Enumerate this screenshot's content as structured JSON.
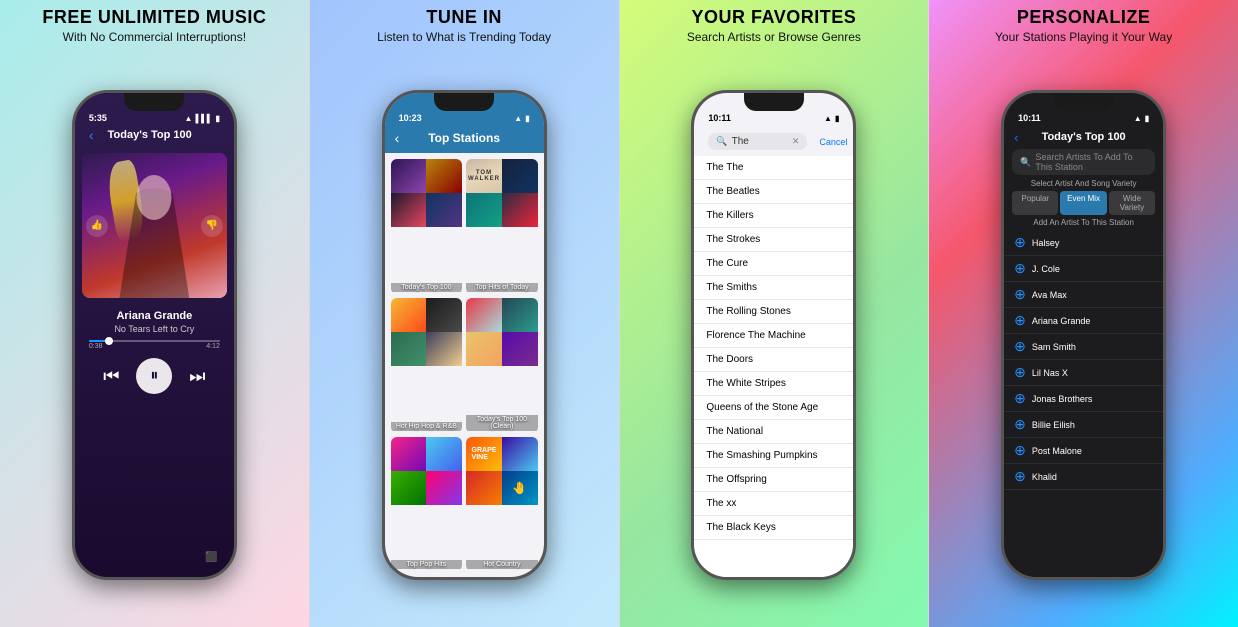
{
  "panels": [
    {
      "id": "panel-1",
      "title": "FREE UNLIMITED MUSIC",
      "subtitle": "With No Commercial Interruptions!",
      "phone": {
        "status_time": "5:35",
        "nav_title": "Today's Top 100",
        "artist": "Ariana Grande",
        "song": "No Tears Left to Cry",
        "time_current": "0:38",
        "time_total": "4:12",
        "progress_pct": 15
      }
    },
    {
      "id": "panel-2",
      "title": "TUNE IN",
      "subtitle": "Listen to What is Trending Today",
      "phone": {
        "status_time": "10:23",
        "nav_title": "Top Stations",
        "stations": [
          {
            "label": "Today's Top 100",
            "cells": [
              "color1",
              "color2",
              "color3",
              "color4"
            ]
          },
          {
            "label": "Top Hits of Today",
            "cells": [
              "tom-walker",
              "color5",
              "color6",
              "color7"
            ]
          },
          {
            "label": "Hot Hip Hop & R&B",
            "cells": [
              "color8",
              "color9",
              "color10",
              "color11"
            ]
          },
          {
            "label": "Today's Top 100 (Clean)",
            "cells": [
              "color12",
              "color13",
              "color14",
              "color15"
            ]
          },
          {
            "label": "Top Pop Hits",
            "cells": [
              "color16",
              "color17",
              "color18",
              "color19"
            ]
          },
          {
            "label": "Hot Country",
            "cells": [
              "color20",
              "color21",
              "color22",
              "color23"
            ]
          }
        ]
      }
    },
    {
      "id": "panel-3",
      "title": "YOUR FAVORITES",
      "subtitle": "Search Artists or Browse Genres",
      "phone": {
        "status_time": "10:11",
        "search_placeholder": "The",
        "cancel_label": "Cancel",
        "results": [
          "The The",
          "The Beatles",
          "The Killers",
          "The Strokes",
          "The Cure",
          "The Smiths",
          "The Rolling Stones",
          "Florence   The Machine",
          "The Doors",
          "The White Stripes",
          "Queens of the Stone Age",
          "The National",
          "The Smashing Pumpkins",
          "The Offspring",
          "The xx",
          "The Black Keys"
        ]
      }
    },
    {
      "id": "panel-4",
      "title": "PERSONALIZE",
      "subtitle": "Your Stations Playing it Your Way",
      "phone": {
        "status_time": "10:11",
        "nav_title": "Today's Top 100",
        "search_placeholder": "Search Artists To Add To This Station",
        "variety_label": "Select Artist And Song Variety",
        "variety_options": [
          "Popular",
          "Even Mix",
          "Wide Variety"
        ],
        "variety_active": "Even Mix",
        "add_artist_label": "Add An Artist To This Station",
        "artists": [
          "Halsey",
          "J. Cole",
          "Ava Max",
          "Ariana Grande",
          "Sam Smith",
          "Lil Nas X",
          "Jonas Brothers",
          "Billie Eilish",
          "Post Malone",
          "Khalid"
        ]
      }
    }
  ]
}
